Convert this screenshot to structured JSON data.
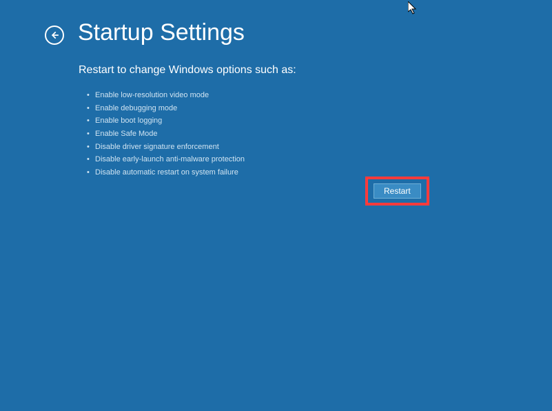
{
  "header": {
    "title": "Startup Settings"
  },
  "content": {
    "subtitle": "Restart to change Windows options such as:",
    "options": [
      "Enable low-resolution video mode",
      "Enable debugging mode",
      "Enable boot logging",
      "Enable Safe Mode",
      "Disable driver signature enforcement",
      "Disable early-launch anti-malware protection",
      "Disable automatic restart on system failure"
    ]
  },
  "actions": {
    "restart_label": "Restart"
  }
}
